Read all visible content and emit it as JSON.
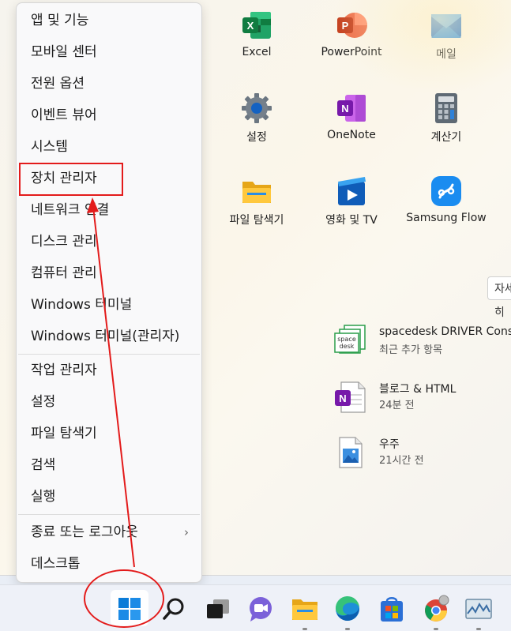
{
  "context_menu": {
    "items": [
      {
        "label": "앱 및 기능"
      },
      {
        "label": "모바일 센터"
      },
      {
        "label": "전원 옵션"
      },
      {
        "label": "이벤트 뷰어"
      },
      {
        "label": "시스템"
      },
      {
        "label": "장치 관리자"
      },
      {
        "label": "네트워크 연결"
      },
      {
        "label": "디스크 관리"
      },
      {
        "label": "컴퓨터 관리"
      },
      {
        "label": "Windows 터미널"
      },
      {
        "label": "Windows 터미널(관리자)"
      },
      {
        "label": "작업 관리자"
      },
      {
        "label": "설정"
      },
      {
        "label": "파일 탐색기"
      },
      {
        "label": "검색"
      },
      {
        "label": "실행"
      },
      {
        "label": "종료 또는 로그아웃"
      },
      {
        "label": "데스크톱"
      }
    ],
    "submenu_chevron": "›"
  },
  "pinned_apps": [
    {
      "label": "Excel",
      "icon": "excel-icon"
    },
    {
      "label": "PowerPoint",
      "icon": "powerpoint-icon"
    },
    {
      "label": "메일",
      "icon": "mail-icon"
    },
    {
      "label": "설정",
      "icon": "settings-gear-icon"
    },
    {
      "label": "OneNote",
      "icon": "onenote-icon"
    },
    {
      "label": "계산기",
      "icon": "calculator-icon"
    },
    {
      "label": "파일 탐색기",
      "icon": "folder-icon"
    },
    {
      "label": "영화 및 TV",
      "icon": "movies-tv-icon"
    },
    {
      "label": "Samsung Flow",
      "icon": "samsung-flow-icon"
    }
  ],
  "recommended_button": "자세히",
  "recommended": [
    {
      "title": "spacedesk DRIVER Console",
      "subtitle": "최근 추가 항목",
      "icon": "spacedesk-icon"
    },
    {
      "title": "블로그 & HTML",
      "subtitle": "24분 전",
      "icon": "onenote-file-icon"
    },
    {
      "title": "우주",
      "subtitle": "21시간 전",
      "icon": "image-file-icon"
    }
  ],
  "colors": {
    "annotation_red": "#e31b1b",
    "excel_green": "#1d7044",
    "powerpoint_orange": "#d24726",
    "onenote_purple": "#7719aa",
    "windows_blue": "#0078d4"
  }
}
